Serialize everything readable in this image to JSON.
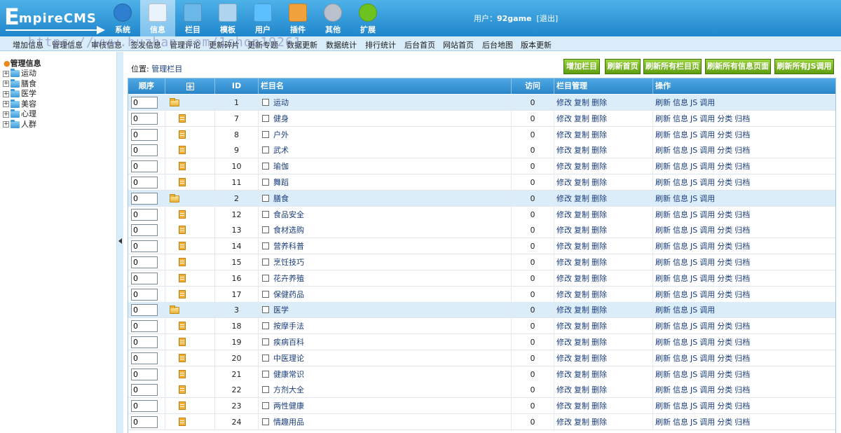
{
  "logo": {
    "big": "E",
    "rest": "mpireCMS"
  },
  "nav": [
    {
      "label": "系统",
      "icon": "globe-icon"
    },
    {
      "label": "信息",
      "icon": "edit-icon",
      "active": true
    },
    {
      "label": "栏目",
      "icon": "folder-icon"
    },
    {
      "label": "模板",
      "icon": "template-icon"
    },
    {
      "label": "用户",
      "icon": "user-icon"
    },
    {
      "label": "插件",
      "icon": "plugin-icon"
    },
    {
      "label": "其他",
      "icon": "gear-icon"
    },
    {
      "label": "扩展",
      "icon": "extend-icon"
    }
  ],
  "user": {
    "label": "用户：",
    "name": "92game",
    "logout": "[退出]"
  },
  "menubar": [
    "增加信息",
    "管理信息",
    "审核信息",
    "签发信息",
    "管理评论",
    "更新碎片",
    "更新专题",
    "数据更新",
    "数据统计",
    "排行统计",
    "后台首页",
    "网站首页",
    "后台地图",
    "版本更新"
  ],
  "watermark": "https://www.huzhan.com/1shop19261",
  "sidebar": {
    "title": "管理信息",
    "nodes": [
      "运动",
      "膳食",
      "医学",
      "美容",
      "心理",
      "人群"
    ]
  },
  "location": {
    "label": "位置:",
    "link": "管理栏目"
  },
  "buttons": [
    "增加栏目",
    "刷新首页",
    "刷新所有栏目页",
    "刷新所有信息页面",
    "刷新所有JS调用"
  ],
  "table": {
    "headers": {
      "order": "顺序",
      "id": "ID",
      "name": "栏目名",
      "visits": "访问",
      "manage": "栏目管理",
      "ops": "操作"
    },
    "manage_links": [
      "修改",
      "复制",
      "删除"
    ],
    "ops_parent": [
      "刷新",
      "信息",
      "JS",
      "调用"
    ],
    "ops_child": [
      "刷新",
      "信息",
      "JS",
      "调用",
      "分类",
      "归档"
    ],
    "rows": [
      {
        "order": "0",
        "id": "1",
        "name": "运动",
        "visits": "0",
        "parent": true
      },
      {
        "order": "0",
        "id": "7",
        "name": "健身",
        "visits": "0",
        "parent": false
      },
      {
        "order": "0",
        "id": "8",
        "name": "户外",
        "visits": "0",
        "parent": false
      },
      {
        "order": "0",
        "id": "9",
        "name": "武术",
        "visits": "0",
        "parent": false
      },
      {
        "order": "0",
        "id": "10",
        "name": "瑜伽",
        "visits": "0",
        "parent": false
      },
      {
        "order": "0",
        "id": "11",
        "name": "舞蹈",
        "visits": "0",
        "parent": false
      },
      {
        "order": "0",
        "id": "2",
        "name": "膳食",
        "visits": "0",
        "parent": true
      },
      {
        "order": "0",
        "id": "12",
        "name": "食品安全",
        "visits": "0",
        "parent": false
      },
      {
        "order": "0",
        "id": "13",
        "name": "食材选购",
        "visits": "0",
        "parent": false
      },
      {
        "order": "0",
        "id": "14",
        "name": "营养科普",
        "visits": "0",
        "parent": false
      },
      {
        "order": "0",
        "id": "15",
        "name": "烹饪技巧",
        "visits": "0",
        "parent": false
      },
      {
        "order": "0",
        "id": "16",
        "name": "花卉养殖",
        "visits": "0",
        "parent": false
      },
      {
        "order": "0",
        "id": "17",
        "name": "保健药品",
        "visits": "0",
        "parent": false
      },
      {
        "order": "0",
        "id": "3",
        "name": "医学",
        "visits": "0",
        "parent": true
      },
      {
        "order": "0",
        "id": "18",
        "name": "按摩手法",
        "visits": "0",
        "parent": false
      },
      {
        "order": "0",
        "id": "19",
        "name": "疾病百科",
        "visits": "0",
        "parent": false
      },
      {
        "order": "0",
        "id": "20",
        "name": "中医理论",
        "visits": "0",
        "parent": false
      },
      {
        "order": "0",
        "id": "21",
        "name": "健康常识",
        "visits": "0",
        "parent": false
      },
      {
        "order": "0",
        "id": "22",
        "name": "方剂大全",
        "visits": "0",
        "parent": false
      },
      {
        "order": "0",
        "id": "23",
        "name": "两性健康",
        "visits": "0",
        "parent": false
      },
      {
        "order": "0",
        "id": "24",
        "name": "情趣用品",
        "visits": "0",
        "parent": false
      }
    ]
  }
}
